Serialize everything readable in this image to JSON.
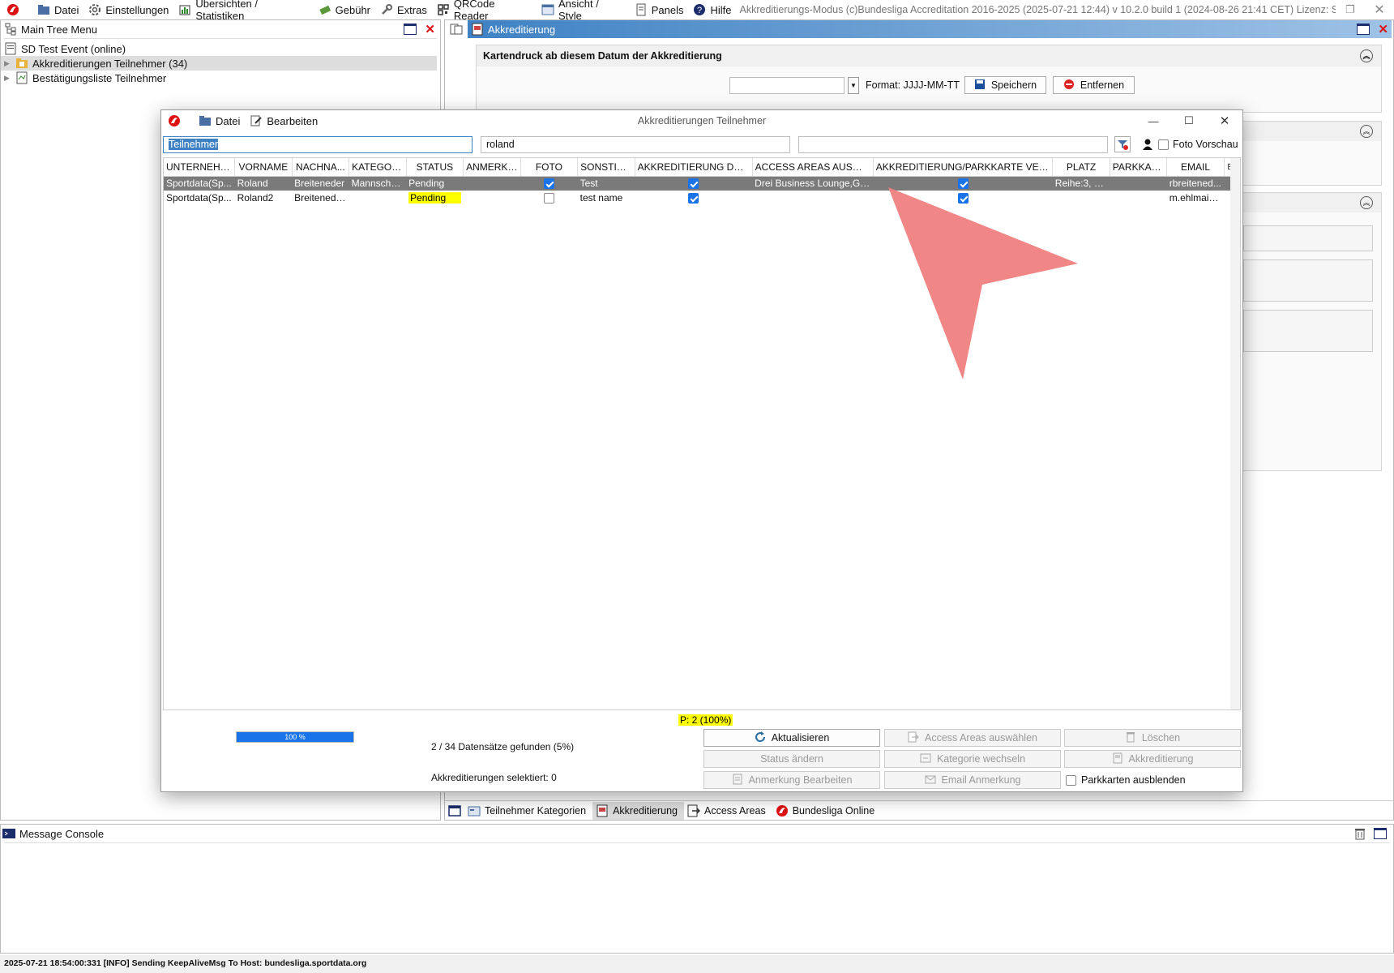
{
  "menu": {
    "items": [
      {
        "label": "Datei",
        "icon": "folder-icon"
      },
      {
        "label": "Einstellungen",
        "icon": "gear-icon"
      },
      {
        "label": "Übersichten / Statistiken",
        "icon": "statistics-icon"
      },
      {
        "label": "Gebühr",
        "icon": "money-icon"
      },
      {
        "label": "Extras",
        "icon": "wrench-icon"
      },
      {
        "label": "QRCode Reader",
        "icon": "qrcode-icon"
      },
      {
        "label": "Ansicht / Style",
        "icon": "view-icon"
      },
      {
        "label": "Panels",
        "icon": "panels-icon"
      },
      {
        "label": "Hilfe",
        "icon": "help-icon"
      }
    ],
    "app_title": "Akkreditierungs-Modus (c)Bundesliga Accreditation 2016-2025 (2025-07-21 12:44) v 10.2.0 build 1 (2024-08-26 21:41 CET) Lizenz: SDI..."
  },
  "left_panel": {
    "title": "Main Tree Menu",
    "tree": [
      {
        "label": "SD Test Event (online)"
      },
      {
        "label": "Akkreditierungen Teilnehmer (34)"
      },
      {
        "label": "Bestätigungsliste Teilnehmer"
      }
    ]
  },
  "right_panel": {
    "title": "Akkreditierung",
    "section1_title": "Kartendruck ab diesem Datum der Akkreditierung",
    "date_value": "",
    "format_label": "Format: JJJJ-MM-TT",
    "save_label": "Speichern",
    "remove_label": "Entfernen",
    "tabs": [
      {
        "label": "Teilnehmer Kategorien"
      },
      {
        "label": "Akkreditierung"
      },
      {
        "label": "Access Areas"
      },
      {
        "label": "Bundesliga Online"
      }
    ]
  },
  "dialog": {
    "title": "Akkreditierungen Teilnehmer",
    "menu_file": "Datei",
    "menu_edit": "Bearbeiten",
    "filter1": "Teilnehmer",
    "filter2": "roland",
    "filter3": "",
    "foto_preview_label": "Foto Vorschau",
    "columns": [
      "UNTERNEHM...",
      "VORNAME",
      "NACHNA...",
      "KATEGORIE",
      "STATUS",
      "ANMERKU...",
      "FOTO",
      "SONSTIGES",
      "AKKREDITIERUNG DRUC...",
      "ACCESS AREAS AUSWÄH...",
      "AKKREDITIERUNG/PARKKARTE VERSCH...",
      "PLATZ",
      "PARKKARTE",
      "EMAIL"
    ],
    "rows": [
      {
        "company": "Sportdata(Sp...",
        "firstname": "Roland",
        "lastname": "Breiteneder",
        "category": "Mannscha...",
        "status": "Pending",
        "note": "",
        "foto": true,
        "other": "Test",
        "print": true,
        "areas": "Drei Business Lounge,Gäst...",
        "sent": true,
        "seat": "Reihe:3, Pla...",
        "parking": "",
        "email": "rbreitened..."
      },
      {
        "company": "Sportdata(Sp...",
        "firstname": "Roland2",
        "lastname": "Breitenede...",
        "category": "",
        "status": "Pending",
        "note": "",
        "foto": false,
        "other": "test name",
        "print": true,
        "areas": "",
        "sent": true,
        "seat": "",
        "parking": "",
        "email": "m.ehlmaie..."
      }
    ],
    "page_info": "P: 2 (100%)",
    "progress_label": "100 %",
    "progress_value": 100,
    "found_text": "2 / 34 Datensätze gefunden (5%)",
    "selected_text": "Akkreditierungen selektiert: 0",
    "buttons": {
      "refresh": "Aktualisieren",
      "access_areas": "Access Areas auswählen",
      "delete": "Löschen",
      "status": "Status ändern",
      "category": "Kategorie wechseln",
      "accreditation": "Akkreditierung",
      "note": "Anmerkung Bearbeiten",
      "email_note": "Email Anmerkung",
      "hide_parking": "Parkkarten ausblenden"
    }
  },
  "console": {
    "title": "Message Console"
  },
  "status_bar": "2025-07-21 18:54:00:331 [INFO] Sending KeepAliveMsg To Host: bundesliga.sportdata.org",
  "colors": {
    "selected_row": "#7a7a7a",
    "highlight": "#ffff00",
    "panel_title_blue": "#3f82c4",
    "progress_blue": "#1a73e8",
    "cursor_red": "#f08080"
  }
}
